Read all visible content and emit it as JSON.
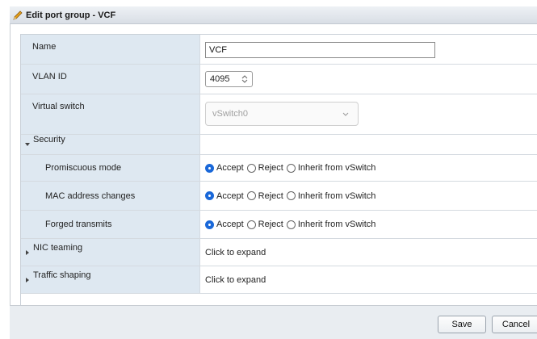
{
  "dialog": {
    "title": "Edit port group - VCF"
  },
  "fields": {
    "name": {
      "label": "Name",
      "value": "VCF"
    },
    "vlan_id": {
      "label": "VLAN ID",
      "value": "4095"
    },
    "virtual_switch": {
      "label": "Virtual switch",
      "value": "vSwitch0"
    }
  },
  "security": {
    "label": "Security",
    "rows": [
      {
        "label": "Promiscuous mode",
        "selected": "Accept"
      },
      {
        "label": "MAC address changes",
        "selected": "Accept"
      },
      {
        "label": "Forged transmits",
        "selected": "Accept"
      }
    ],
    "options": [
      "Accept",
      "Reject",
      "Inherit from vSwitch"
    ]
  },
  "nic_teaming": {
    "label": "NIC teaming",
    "value": "Click to expand"
  },
  "traffic_shaping": {
    "label": "Traffic shaping",
    "value": "Click to expand"
  },
  "buttons": {
    "save": "Save",
    "cancel": "Cancel"
  },
  "colors": {
    "accent": "#1a68d9",
    "label_bg": "#dee8f1"
  },
  "icons": {
    "title": "pencil-icon"
  }
}
